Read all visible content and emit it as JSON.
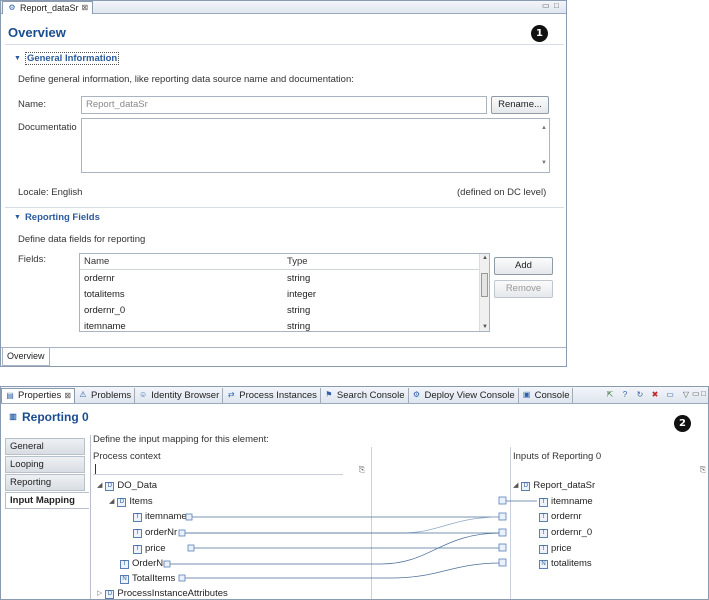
{
  "editor": {
    "tab_label": "Report_dataSr",
    "tab_close": "⊠",
    "overview_title": "Overview",
    "marker": "1",
    "general": {
      "title": "General Information",
      "description": "Define general information, like reporting data source name and documentation:",
      "name_label": "Name:",
      "name_value": "Report_dataSr",
      "rename_button": "Rename...",
      "documentation_label": "Documentatio",
      "locale_label": "Locale: English",
      "locale_note": "(defined on DC level)"
    },
    "reporting_fields": {
      "title": "Reporting Fields",
      "description": "Define data fields for reporting",
      "fields_label": "Fields:",
      "columns": [
        "Name",
        "Type"
      ],
      "rows": [
        [
          "ordernr",
          "string"
        ],
        [
          "totalitems",
          "integer"
        ],
        [
          "ordernr_0",
          "string"
        ],
        [
          "itemname",
          "string"
        ]
      ],
      "add_button": "Add",
      "remove_button": "Remove"
    },
    "bottom_tab": "Overview"
  },
  "props": {
    "tabs": [
      {
        "label": "Properties",
        "icon": "properties-icon"
      },
      {
        "label": "Problems",
        "icon": "problems-icon"
      },
      {
        "label": "Identity Browser",
        "icon": "identity-icon"
      },
      {
        "label": "Process Instances",
        "icon": "process-icon"
      },
      {
        "label": "Search Console",
        "icon": "search-icon"
      },
      {
        "label": "Deploy View Console",
        "icon": "gear-icon"
      },
      {
        "label": "Console",
        "icon": "console-icon"
      }
    ],
    "title": "Reporting 0",
    "marker": "2",
    "left_tabs": [
      "General",
      "Looping",
      "Reporting",
      "Input Mapping"
    ],
    "description": "Define the input mapping for this element:",
    "process_context_header": "Process context",
    "inputs_header": "Inputs of Reporting 0",
    "left_tree": [
      {
        "label": "DO_Data",
        "icon": "D"
      },
      {
        "label": "Items",
        "icon": "D"
      },
      {
        "label": "itemname",
        "icon": "T"
      },
      {
        "label": "orderNr",
        "icon": "T"
      },
      {
        "label": "price",
        "icon": "T"
      },
      {
        "label": "OrderNr",
        "icon": "T"
      },
      {
        "label": "TotalItems",
        "icon": "N"
      },
      {
        "label": "ProcessInstanceAttributes",
        "icon": "D"
      }
    ],
    "right_tree": [
      {
        "label": "Report_dataSr",
        "icon": "D"
      },
      {
        "label": "itemname",
        "icon": "T"
      },
      {
        "label": "ordernr",
        "icon": "T"
      },
      {
        "label": "ordernr_0",
        "icon": "T"
      },
      {
        "label": "price",
        "icon": "T"
      },
      {
        "label": "totalitems",
        "icon": "N"
      }
    ]
  }
}
